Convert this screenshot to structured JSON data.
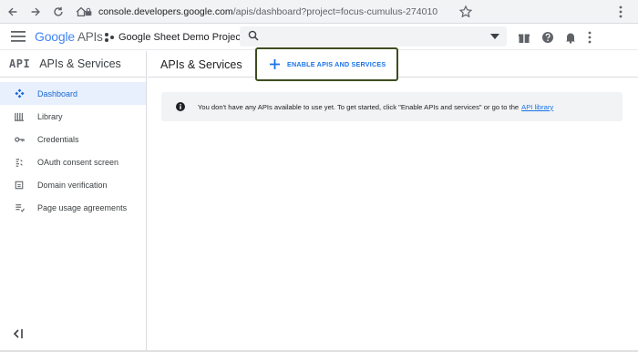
{
  "browser": {
    "url_host": "console.developers.google.com",
    "url_path": "/apis/dashboard?project=focus-cumulus-274010",
    "nav_icons": [
      "back-icon",
      "forward-icon",
      "reload-icon",
      "home-icon"
    ]
  },
  "header": {
    "logo_google": "Google",
    "logo_suffix": "APIs",
    "project_name": "Google Sheet Demo Project",
    "search_placeholder": "",
    "icons": [
      "gift-icon",
      "help-icon",
      "notifications-icon",
      "more-icon"
    ]
  },
  "sidebar": {
    "api_mark": "API",
    "title": "APIs & Services",
    "items": [
      {
        "label": "Dashboard",
        "icon": "dashboard-icon",
        "active": true
      },
      {
        "label": "Library",
        "icon": "library-icon",
        "active": false
      },
      {
        "label": "Credentials",
        "icon": "key-icon",
        "active": false
      },
      {
        "label": "OAuth consent screen",
        "icon": "consent-icon",
        "active": false
      },
      {
        "label": "Domain verification",
        "icon": "domain-icon",
        "active": false
      },
      {
        "label": "Page usage agreements",
        "icon": "agreements-icon",
        "active": false
      }
    ]
  },
  "main": {
    "title": "APIs & Services",
    "enable_button": "ENABLE APIS AND SERVICES",
    "notice_text": "You don't have any APIs available to use yet. To get started, click \"Enable APIs and services\" or go to the",
    "notice_link": "API library"
  },
  "colors": {
    "accent": "#1a73e8",
    "active_bg": "#e8f0fe",
    "highlight_border": "#3d4d1f"
  }
}
